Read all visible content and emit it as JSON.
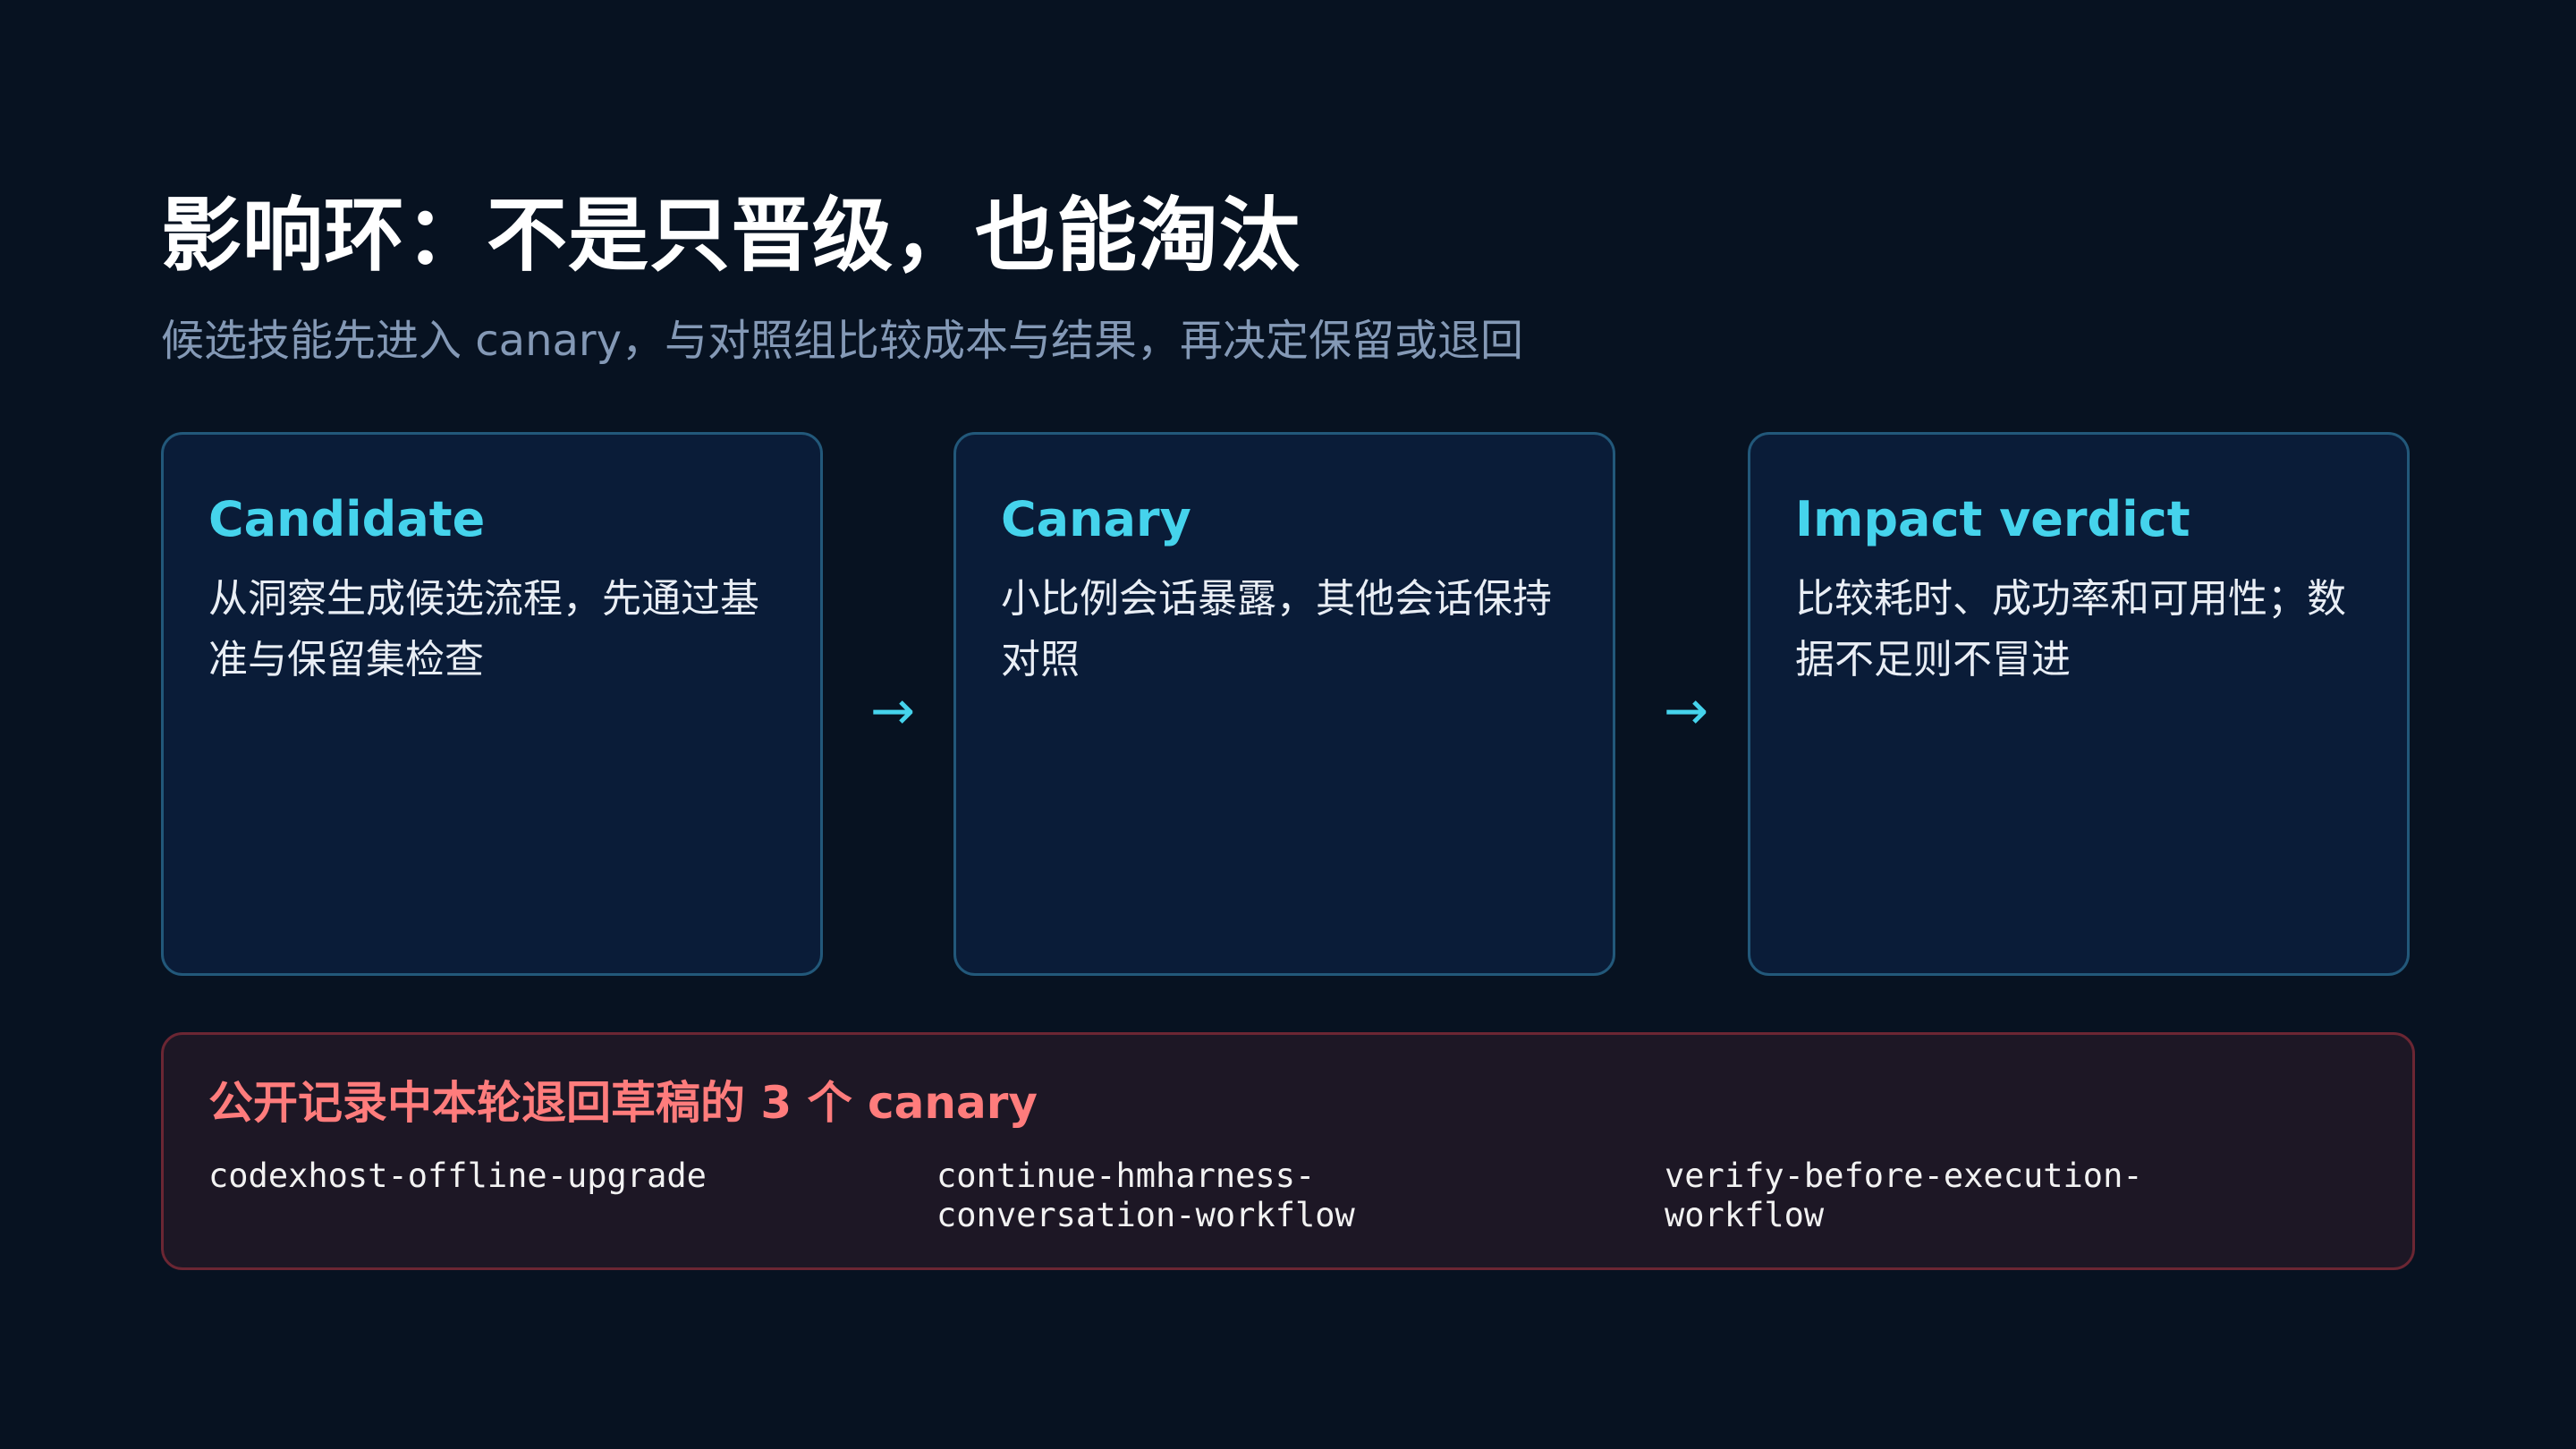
{
  "slide": {
    "title": "影响环：不是只晋级，也能淘汰",
    "subtitle": "候选技能先进入 canary，与对照组比较成本与结果，再决定保留或退回"
  },
  "stages": [
    {
      "title": "Candidate",
      "description": "从洞察生成候选流程，先通过基准与保留集检查"
    },
    {
      "title": "Canary",
      "description": "小比例会话暴露，其他会话保持对照"
    },
    {
      "title": "Impact verdict",
      "description": "比较耗时、成功率和可用性；数据不足则不冒进"
    }
  ],
  "arrows": [
    "→",
    "→"
  ],
  "canary_panel": {
    "title": "公开记录中本轮退回草稿的 3 个 canary",
    "items": [
      "codexhost-offline-upgrade",
      "continue-hmharness-conversation-workflow",
      "verify-before-execution-workflow"
    ]
  },
  "colors": {
    "background": "#071221",
    "card_background": "#0a1c38",
    "card_border": "#22587a",
    "accent": "#45d3ec",
    "warning_accent": "#ff7c7c",
    "warning_border": "#6b2633",
    "subtitle": "#8499b6"
  }
}
